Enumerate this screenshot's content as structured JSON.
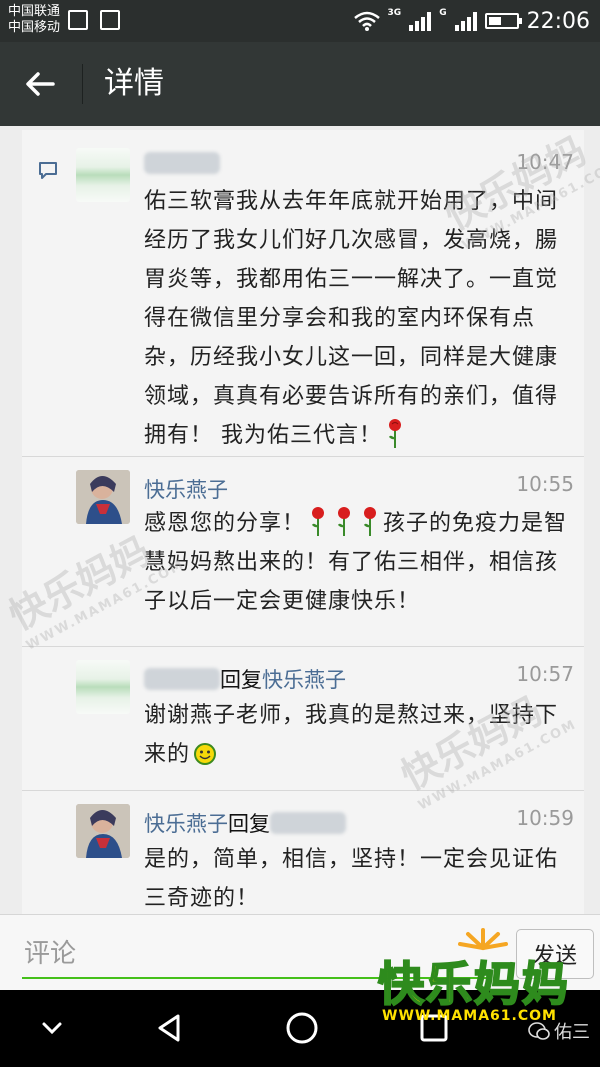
{
  "status_bar": {
    "carrier_1": "中国联通",
    "carrier_2": "中国移动",
    "network_1": "3G",
    "network_2": "G",
    "time": "22:06"
  },
  "header": {
    "title": "详情"
  },
  "comments": [
    {
      "name": "",
      "time": "10:47",
      "text": "佑三软膏我从去年年底就开始用了，中间经历了我女儿们好几次感冒，发高烧，腸胃炎等，我都用佑三一一解决了。一直觉得在微信里分享会和我的室内环保有点杂，历经我小女儿这一回，同样是大健康领域，真真有必要告诉所有的亲们，值得拥有！ 我为佑三代言！"
    },
    {
      "name": "快乐燕子",
      "time": "10:55",
      "text_before": "感恩您的分享！",
      "text_after": "孩子的免疫力是智慧妈妈熬出来的！有了佑三相伴，相信孩子以后一定会更健康快乐！"
    },
    {
      "name": "",
      "reply_word": "回复",
      "reply_to": "快乐燕子",
      "time": "10:57",
      "text": "谢谢燕子老师，我真的是熬过来，坚持下来的"
    },
    {
      "name": "快乐燕子",
      "reply_word": "回复",
      "reply_to": "",
      "time": "10:59",
      "text": "是的，简单，相信，坚持！一定会见证佑三奇迹的！"
    }
  ],
  "input_bar": {
    "placeholder": "评论",
    "send_label": "发送"
  },
  "watermarks": {
    "brand": "快乐妈妈",
    "url": "WWW.MAMA61.COM",
    "account": "佑三"
  },
  "colors": {
    "status_bar": "#2b2f2e",
    "title_bar": "#323736",
    "name_link": "#4b6d94",
    "input_accent": "#45c01a"
  }
}
